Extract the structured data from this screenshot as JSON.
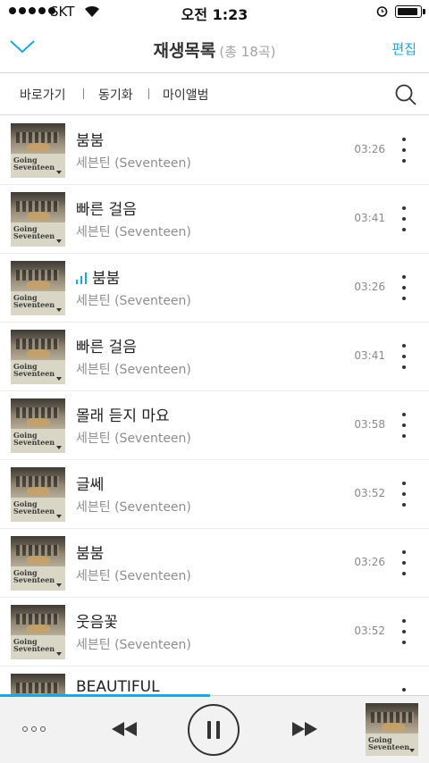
{
  "status_bar": {
    "carrier": "SKT",
    "time": "오전 1:23"
  },
  "header": {
    "title": "재생목록",
    "count": "(총 18곡)",
    "edit": "편집"
  },
  "toolbar": {
    "items": [
      "바로가기",
      "동기화",
      "마이앨범"
    ]
  },
  "album": {
    "line1": "Going",
    "line2": "Seventeen"
  },
  "songs": [
    {
      "title": "붐붐",
      "artist": "세븐틴 (Seventeen)",
      "duration": "03:26",
      "playing": false
    },
    {
      "title": "빠른 걸음",
      "artist": "세븐틴 (Seventeen)",
      "duration": "03:41",
      "playing": false
    },
    {
      "title": "붐붐",
      "artist": "세븐틴 (Seventeen)",
      "duration": "03:26",
      "playing": true
    },
    {
      "title": "빠른 걸음",
      "artist": "세븐틴 (Seventeen)",
      "duration": "03:41",
      "playing": false
    },
    {
      "title": "몰래 듣지 마요",
      "artist": "세븐틴 (Seventeen)",
      "duration": "03:58",
      "playing": false
    },
    {
      "title": "글쎄",
      "artist": "세븐틴 (Seventeen)",
      "duration": "03:52",
      "playing": false
    },
    {
      "title": "붐붐",
      "artist": "세븐틴 (Seventeen)",
      "duration": "03:26",
      "playing": false
    },
    {
      "title": "웃음꽃",
      "artist": "세븐틴 (Seventeen)",
      "duration": "03:52",
      "playing": false
    },
    {
      "title": "BEAUTIFUL",
      "artist": "",
      "duration": "",
      "playing": false
    }
  ],
  "player": {
    "progress": 0.49
  },
  "colors": {
    "accent": "#1aa8dd"
  }
}
